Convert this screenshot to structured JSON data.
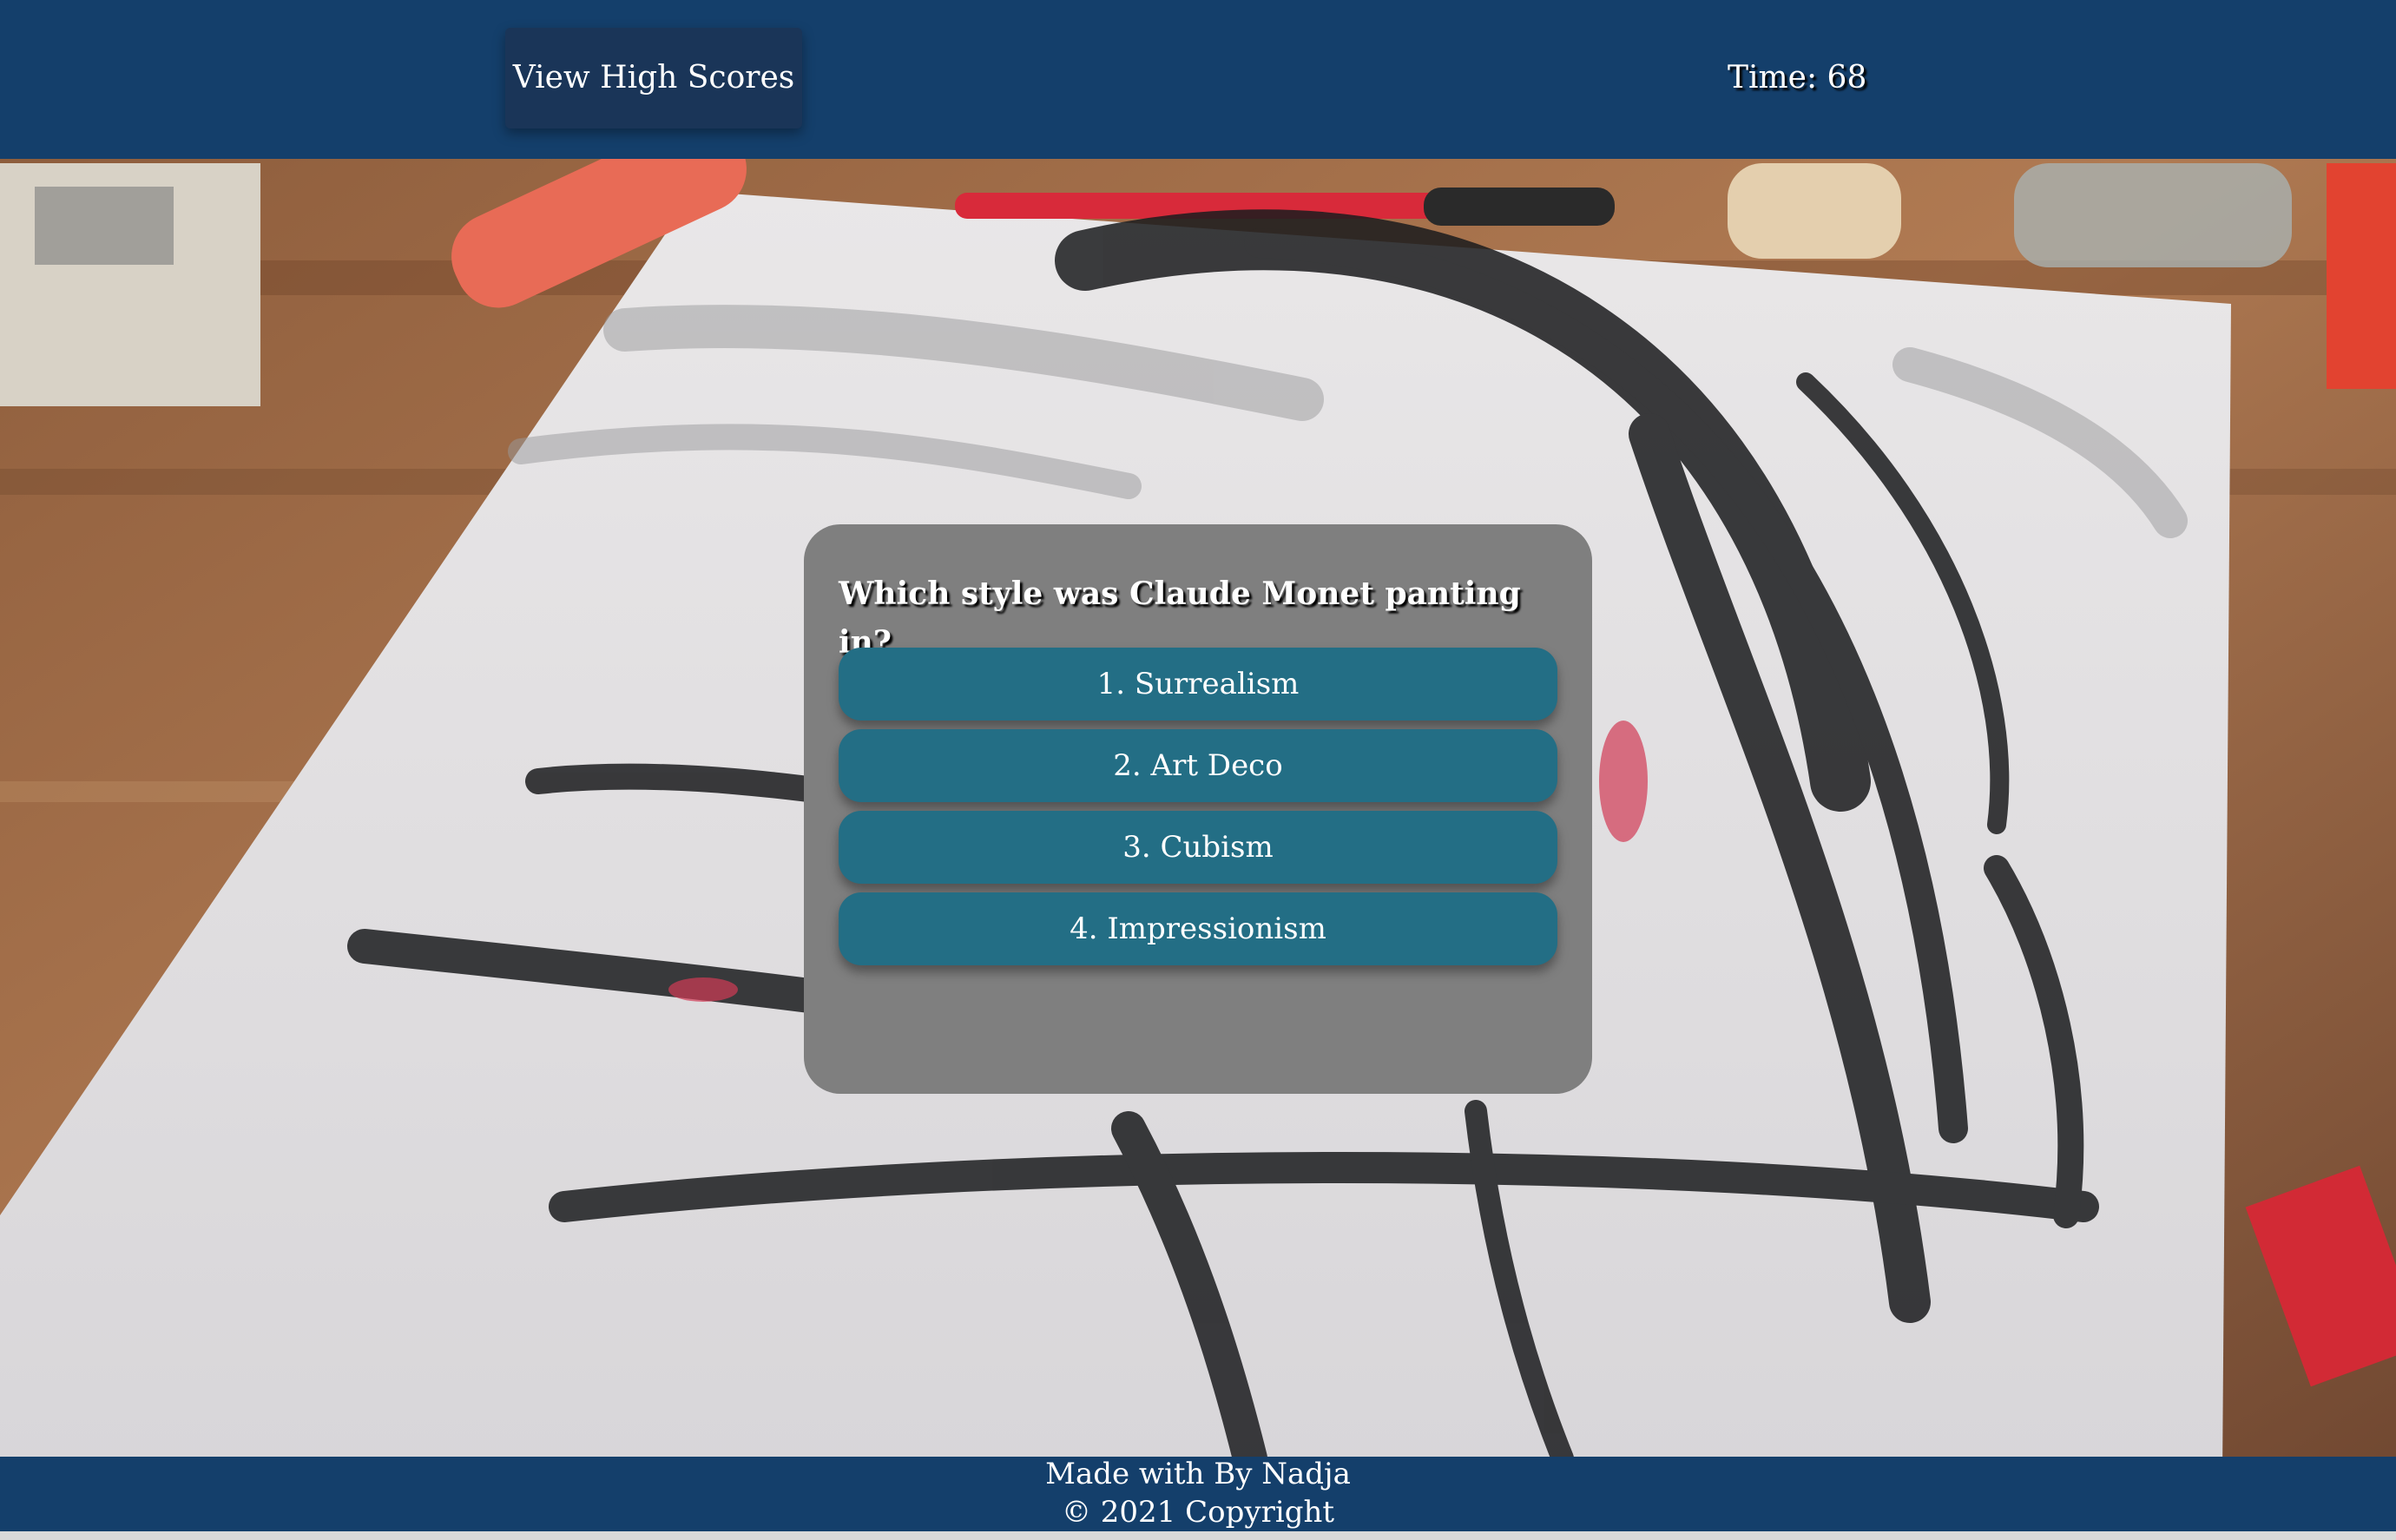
{
  "header": {
    "high_scores_label": "View High Scores",
    "timer_label": "Time: 68"
  },
  "quiz": {
    "question": "Which style was Claude Monet panting in?",
    "answers": [
      "1. Surrealism",
      "2. Art Deco",
      "3. Cubism",
      "4. Impressionism"
    ]
  },
  "footer": {
    "credit": "Made with By Nadja",
    "copyright": "© 2021 Copyright"
  },
  "colors": {
    "header_bg": "#143f6b",
    "button_bg": "#1a3558",
    "card_bg": "#7f7f7f",
    "answer_bg": "#236e85"
  }
}
